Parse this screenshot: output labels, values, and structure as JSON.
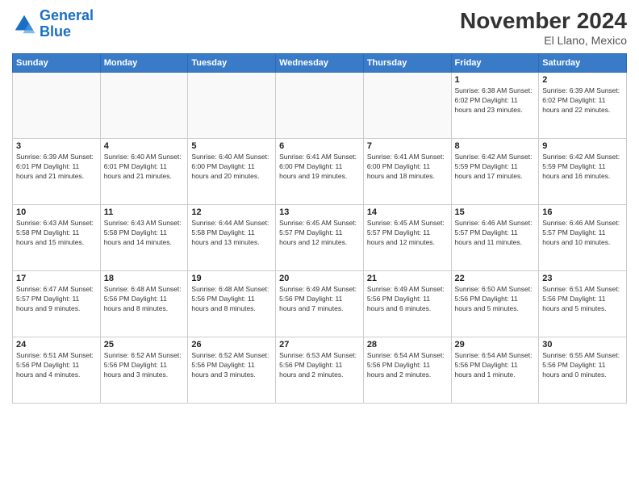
{
  "logo": {
    "line1": "General",
    "line2": "Blue"
  },
  "title": "November 2024",
  "location": "El Llano, Mexico",
  "days_of_week": [
    "Sunday",
    "Monday",
    "Tuesday",
    "Wednesday",
    "Thursday",
    "Friday",
    "Saturday"
  ],
  "weeks": [
    [
      {
        "day": "",
        "info": ""
      },
      {
        "day": "",
        "info": ""
      },
      {
        "day": "",
        "info": ""
      },
      {
        "day": "",
        "info": ""
      },
      {
        "day": "",
        "info": ""
      },
      {
        "day": "1",
        "info": "Sunrise: 6:38 AM\nSunset: 6:02 PM\nDaylight: 11 hours and 23 minutes."
      },
      {
        "day": "2",
        "info": "Sunrise: 6:39 AM\nSunset: 6:02 PM\nDaylight: 11 hours and 22 minutes."
      }
    ],
    [
      {
        "day": "3",
        "info": "Sunrise: 6:39 AM\nSunset: 6:01 PM\nDaylight: 11 hours and 21 minutes."
      },
      {
        "day": "4",
        "info": "Sunrise: 6:40 AM\nSunset: 6:01 PM\nDaylight: 11 hours and 21 minutes."
      },
      {
        "day": "5",
        "info": "Sunrise: 6:40 AM\nSunset: 6:00 PM\nDaylight: 11 hours and 20 minutes."
      },
      {
        "day": "6",
        "info": "Sunrise: 6:41 AM\nSunset: 6:00 PM\nDaylight: 11 hours and 19 minutes."
      },
      {
        "day": "7",
        "info": "Sunrise: 6:41 AM\nSunset: 6:00 PM\nDaylight: 11 hours and 18 minutes."
      },
      {
        "day": "8",
        "info": "Sunrise: 6:42 AM\nSunset: 5:59 PM\nDaylight: 11 hours and 17 minutes."
      },
      {
        "day": "9",
        "info": "Sunrise: 6:42 AM\nSunset: 5:59 PM\nDaylight: 11 hours and 16 minutes."
      }
    ],
    [
      {
        "day": "10",
        "info": "Sunrise: 6:43 AM\nSunset: 5:58 PM\nDaylight: 11 hours and 15 minutes."
      },
      {
        "day": "11",
        "info": "Sunrise: 6:43 AM\nSunset: 5:58 PM\nDaylight: 11 hours and 14 minutes."
      },
      {
        "day": "12",
        "info": "Sunrise: 6:44 AM\nSunset: 5:58 PM\nDaylight: 11 hours and 13 minutes."
      },
      {
        "day": "13",
        "info": "Sunrise: 6:45 AM\nSunset: 5:57 PM\nDaylight: 11 hours and 12 minutes."
      },
      {
        "day": "14",
        "info": "Sunrise: 6:45 AM\nSunset: 5:57 PM\nDaylight: 11 hours and 12 minutes."
      },
      {
        "day": "15",
        "info": "Sunrise: 6:46 AM\nSunset: 5:57 PM\nDaylight: 11 hours and 11 minutes."
      },
      {
        "day": "16",
        "info": "Sunrise: 6:46 AM\nSunset: 5:57 PM\nDaylight: 11 hours and 10 minutes."
      }
    ],
    [
      {
        "day": "17",
        "info": "Sunrise: 6:47 AM\nSunset: 5:57 PM\nDaylight: 11 hours and 9 minutes."
      },
      {
        "day": "18",
        "info": "Sunrise: 6:48 AM\nSunset: 5:56 PM\nDaylight: 11 hours and 8 minutes."
      },
      {
        "day": "19",
        "info": "Sunrise: 6:48 AM\nSunset: 5:56 PM\nDaylight: 11 hours and 8 minutes."
      },
      {
        "day": "20",
        "info": "Sunrise: 6:49 AM\nSunset: 5:56 PM\nDaylight: 11 hours and 7 minutes."
      },
      {
        "day": "21",
        "info": "Sunrise: 6:49 AM\nSunset: 5:56 PM\nDaylight: 11 hours and 6 minutes."
      },
      {
        "day": "22",
        "info": "Sunrise: 6:50 AM\nSunset: 5:56 PM\nDaylight: 11 hours and 5 minutes."
      },
      {
        "day": "23",
        "info": "Sunrise: 6:51 AM\nSunset: 5:56 PM\nDaylight: 11 hours and 5 minutes."
      }
    ],
    [
      {
        "day": "24",
        "info": "Sunrise: 6:51 AM\nSunset: 5:56 PM\nDaylight: 11 hours and 4 minutes."
      },
      {
        "day": "25",
        "info": "Sunrise: 6:52 AM\nSunset: 5:56 PM\nDaylight: 11 hours and 3 minutes."
      },
      {
        "day": "26",
        "info": "Sunrise: 6:52 AM\nSunset: 5:56 PM\nDaylight: 11 hours and 3 minutes."
      },
      {
        "day": "27",
        "info": "Sunrise: 6:53 AM\nSunset: 5:56 PM\nDaylight: 11 hours and 2 minutes."
      },
      {
        "day": "28",
        "info": "Sunrise: 6:54 AM\nSunset: 5:56 PM\nDaylight: 11 hours and 2 minutes."
      },
      {
        "day": "29",
        "info": "Sunrise: 6:54 AM\nSunset: 5:56 PM\nDaylight: 11 hours and 1 minute."
      },
      {
        "day": "30",
        "info": "Sunrise: 6:55 AM\nSunset: 5:56 PM\nDaylight: 11 hours and 0 minutes."
      }
    ]
  ]
}
